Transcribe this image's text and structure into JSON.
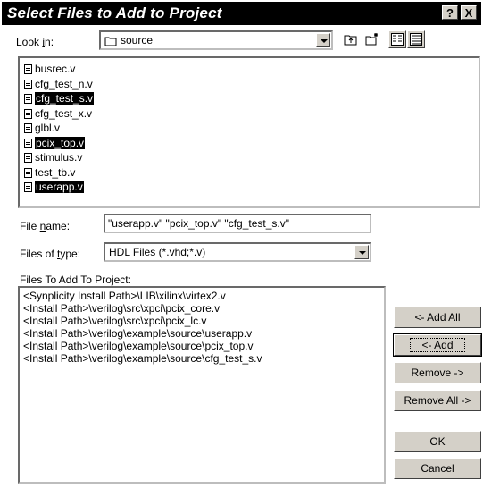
{
  "window": {
    "title": "Select Files to Add to Project",
    "help_label": "?",
    "close_label": "X"
  },
  "look_in": {
    "label_pre": "Look ",
    "label_key": "i",
    "label_post": "n:",
    "value": "source"
  },
  "file_list": [
    {
      "name": "busrec.v",
      "selected": false
    },
    {
      "name": "cfg_test_n.v",
      "selected": false
    },
    {
      "name": "cfg_test_s.v",
      "selected": true
    },
    {
      "name": "cfg_test_x.v",
      "selected": false
    },
    {
      "name": "glbl.v",
      "selected": false
    },
    {
      "name": "pcix_top.v",
      "selected": true
    },
    {
      "name": "stimulus.v",
      "selected": false
    },
    {
      "name": "test_tb.v",
      "selected": false
    },
    {
      "name": "userapp.v",
      "selected": true
    }
  ],
  "file_name": {
    "label_pre": "File ",
    "label_key": "n",
    "label_post": "ame:",
    "value": "\"userapp.v\" \"pcix_top.v\" \"cfg_test_s.v\""
  },
  "file_type": {
    "label_pre": "Files of ",
    "label_key": "t",
    "label_post": "ype:",
    "value": "HDL Files (*.vhd;*.v)"
  },
  "project_files": {
    "label": "Files To Add To Project:",
    "items": [
      "<Synplicity Install Path>\\LIB\\xilinx\\virtex2.v",
      "<Install Path>\\verilog\\src\\xpci\\pcix_core.v",
      "<Install Path>\\verilog\\src\\xpci\\pcix_lc.v",
      "<Install Path>\\verilog\\example\\source\\userapp.v",
      "<Install Path>\\verilog\\example\\source\\pcix_top.v",
      "<Install Path>\\verilog\\example\\source\\cfg_test_s.v"
    ]
  },
  "buttons": {
    "add_all": "<- Add All",
    "add": "<- Add",
    "remove": "Remove ->",
    "remove_all": "Remove All ->",
    "ok": "OK",
    "cancel": "Cancel"
  }
}
